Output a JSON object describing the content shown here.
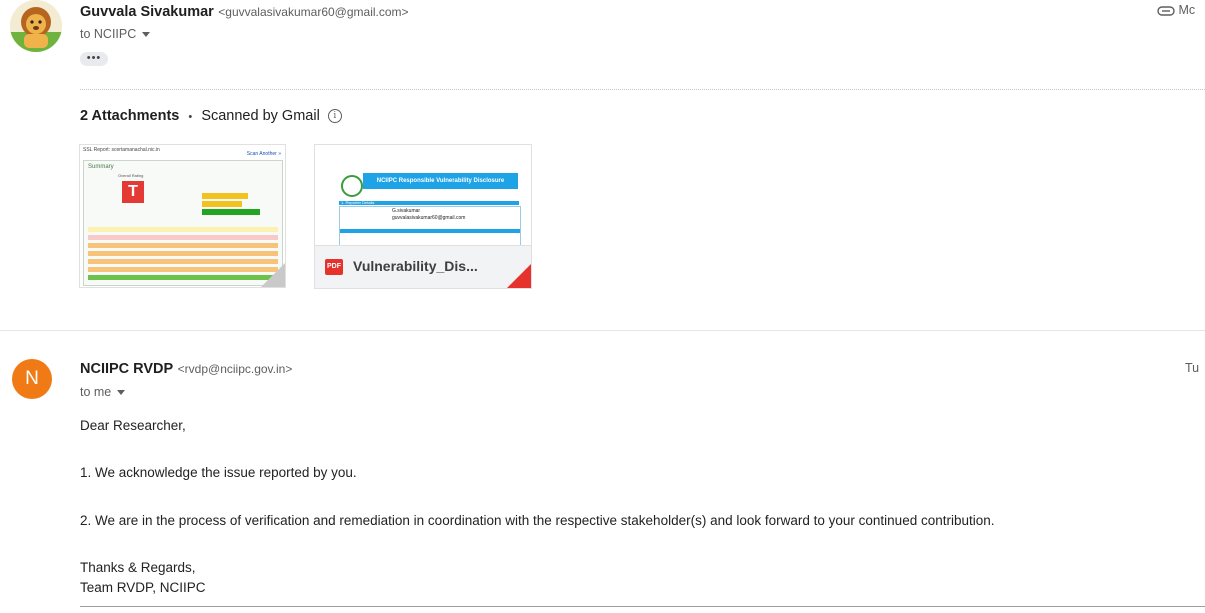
{
  "message1": {
    "sender_name": "Guvvala Sivakumar",
    "sender_email": "<guvvalasivakumar60@gmail.com>",
    "to_line": "to NCIIPC",
    "more_button": "•••",
    "date_partial": "Mc",
    "attachments_heading": "2 Attachments",
    "separator": "•",
    "scanned_text": "Scanned by Gmail",
    "attachments": [
      {
        "preview_title": "SSL Report: scertamanachal.nic.in",
        "preview_link": "Scan Another »",
        "summary_label": "Summary",
        "overall_rating_label": "Overall Rating",
        "grade": "T"
      },
      {
        "file_type_badge": "PDF",
        "file_name": "Vulnerability_Dis...",
        "preview_header": "NCIIPC Responsible Vulnerability Disclosure",
        "preview_section": "1. Reporter Details",
        "preview_name": "G.sivakumar",
        "preview_email": "guvvalasivakumar60@gmail.com"
      }
    ]
  },
  "message2": {
    "avatar_letter": "N",
    "sender_name": "NCIIPC RVDP",
    "sender_email": "<rvdp@nciipc.gov.in>",
    "to_line": "to me",
    "date_partial": "Tu",
    "body": {
      "greeting": "Dear Researcher,",
      "line1": "1. We acknowledge the issue reported by you.",
      "line2": "2. We are in the process of verification and remediation in coordination with the respective stakeholder(s) and look forward to your continued contribution.",
      "closing": "Thanks & Regards,",
      "signature": "Team RVDP, NCIIPC"
    }
  }
}
